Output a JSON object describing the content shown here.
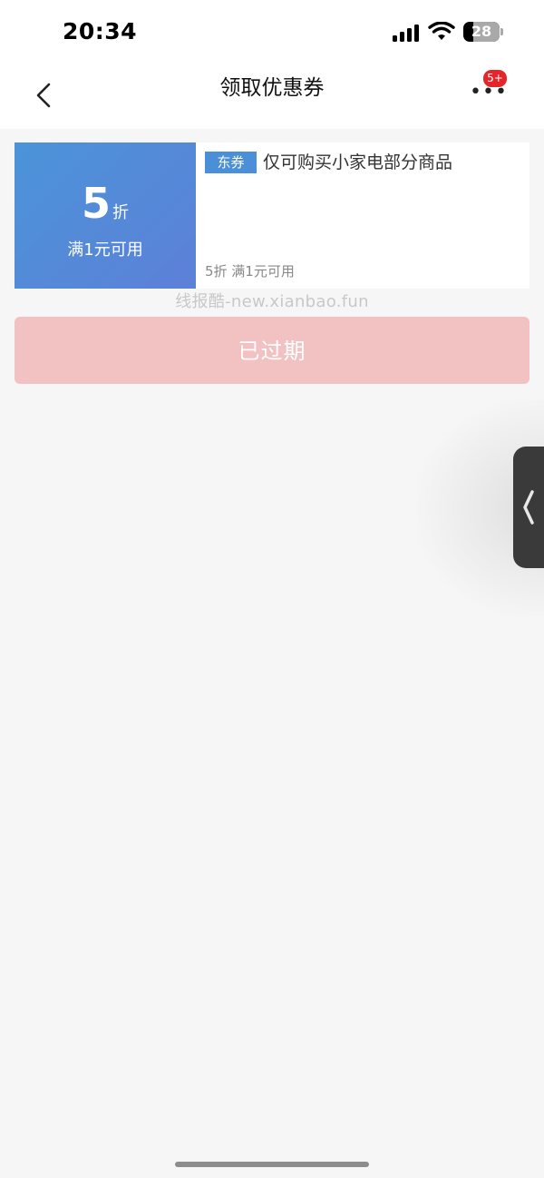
{
  "status_bar": {
    "time": "20:34",
    "battery_level": "28"
  },
  "nav": {
    "title": "领取优惠券",
    "badge": "5+"
  },
  "coupon": {
    "discount_value": "5",
    "discount_unit": "折",
    "condition": "满1元可用",
    "tag": "东券",
    "description": "仅可购买小家电部分商品",
    "summary": "5折 满1元可用",
    "colors": {
      "left_gradient_start": "#4b94d9",
      "left_gradient_end": "#5d80d8",
      "tag_bg": "#4b8fd8"
    }
  },
  "watermark": "线报酷-new.xianbao.fun",
  "action": {
    "label": "已过期",
    "bg_color": "#f2c1c2"
  }
}
